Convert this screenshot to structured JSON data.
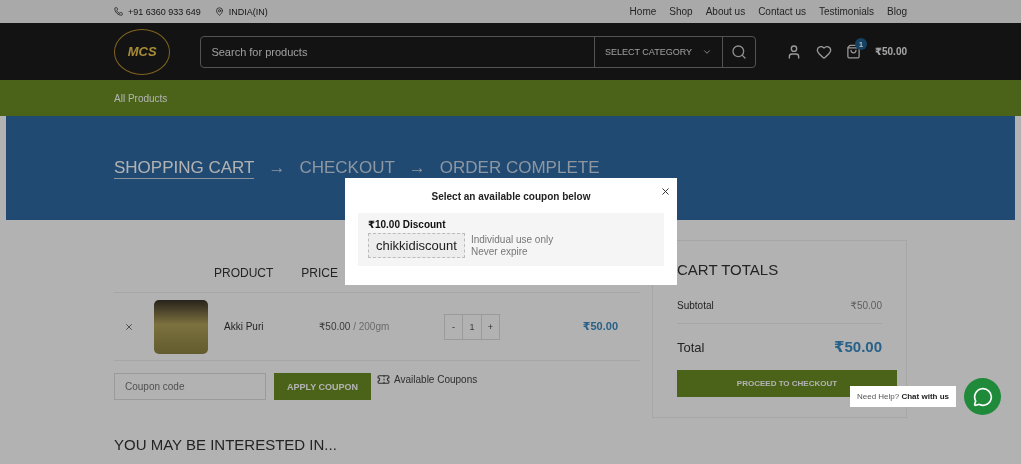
{
  "topbar": {
    "phone": "+91 6360 933 649",
    "location": "INDIA(IN)",
    "links": [
      "Home",
      "Shop",
      "About us",
      "Contact us",
      "Testimonials",
      "Blog"
    ]
  },
  "header": {
    "logo": "MCS",
    "search": {
      "placeholder": "Search for products"
    },
    "category": "SELECT CATEGORY",
    "cart_count": "1",
    "cart_total": "₹50.00"
  },
  "nav": {
    "items": [
      "All Products"
    ]
  },
  "breadcrumb": [
    {
      "label": "SHOPPING CART",
      "selected": true
    },
    {
      "label": "CHECKOUT",
      "selected": false
    },
    {
      "label": "ORDER COMPLETE",
      "selected": false
    }
  ],
  "breadcrumb_separator": "→",
  "cart": {
    "columns": [
      "PRODUCT",
      "PRICE"
    ],
    "rows": [
      {
        "name": "Akki Puri",
        "price": "₹50.00",
        "unit": "/ 200gm",
        "quantity": "1",
        "subtotal": "₹50.00"
      }
    ],
    "decrease": "-",
    "increase": "+",
    "coupon": {
      "placeholder": "Coupon code"
    },
    "apply_button": "APPLY COUPON",
    "available_link": "Available Coupons"
  },
  "totals": {
    "title": "CART TOTALS",
    "subtotal_label": "Subtotal",
    "subtotal": "₹50.00",
    "total_label": "Total",
    "total": "₹50.00",
    "checkout_button": "PROCEED TO CHECKOUT"
  },
  "related_heading": "YOU MAY BE INTERESTED IN...",
  "chat": {
    "prompt": "Need Help?",
    "action": "Chat with us"
  },
  "modal": {
    "title": "Select an available coupon below",
    "coupons": [
      {
        "amount": "₹10.00 Discount",
        "code": "chikkidiscount",
        "notes": [
          "Individual use only",
          "Never expire"
        ]
      }
    ]
  }
}
